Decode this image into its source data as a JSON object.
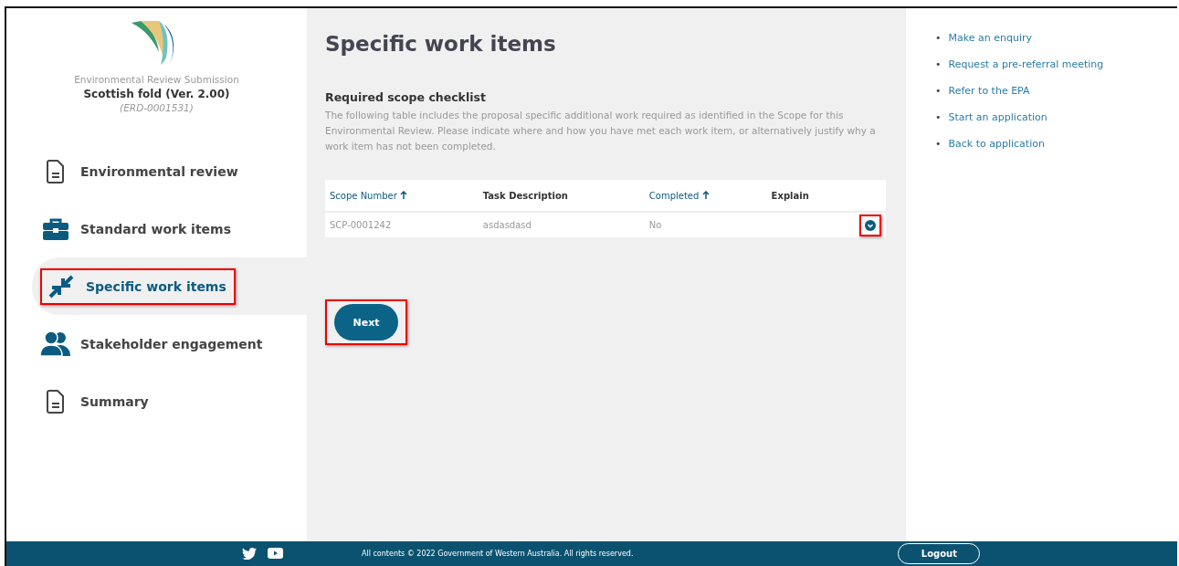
{
  "sidebar": {
    "subtitle": "Environmental Review Submission",
    "title": "Scottish fold (Ver. 2.00)",
    "reference": "(ERD-0001531)",
    "items": [
      {
        "label": "Environmental review",
        "kind": "document",
        "selected": false,
        "highlighted": false
      },
      {
        "label": "Standard work items",
        "kind": "briefcase",
        "selected": false,
        "highlighted": false
      },
      {
        "label": "Specific work items",
        "kind": "arrows",
        "selected": true,
        "highlighted": true
      },
      {
        "label": "Stakeholder engagement",
        "kind": "people",
        "selected": false,
        "highlighted": false
      },
      {
        "label": "Summary",
        "kind": "document",
        "selected": false,
        "highlighted": false
      }
    ]
  },
  "main": {
    "title": "Specific work items",
    "section_title": "Required scope checklist",
    "description": "The following table includes the proposal specific additional work required as identified in the Scope for this Environmental Review. Please indicate where and how you have met each work item, or alternatively justify why a work item has not been completed.",
    "table": {
      "columns": [
        {
          "label": "Scope Number",
          "sortable": true
        },
        {
          "label": "Task Description",
          "sortable": false
        },
        {
          "label": "Completed",
          "sortable": true
        },
        {
          "label": "Explain",
          "sortable": false
        }
      ],
      "rows": [
        {
          "cells": [
            "SCP-0001242",
            "asdasdasd",
            "No",
            ""
          ],
          "expand_highlighted": true
        }
      ]
    },
    "next_button": {
      "label": "Next",
      "highlighted": true
    }
  },
  "links": [
    {
      "marker": "•",
      "label": "Make an enquiry"
    },
    {
      "marker": "•",
      "label": "Request a pre-referral meeting"
    },
    {
      "marker": "•",
      "label": "Refer to the EPA"
    },
    {
      "marker": "•",
      "label": "Start an application"
    },
    {
      "marker": "•",
      "label": "Back to application"
    }
  ],
  "footer": {
    "copyright": "All contents © 2022 Government of Western Australia. All rights reserved.",
    "logout": "Logout"
  }
}
